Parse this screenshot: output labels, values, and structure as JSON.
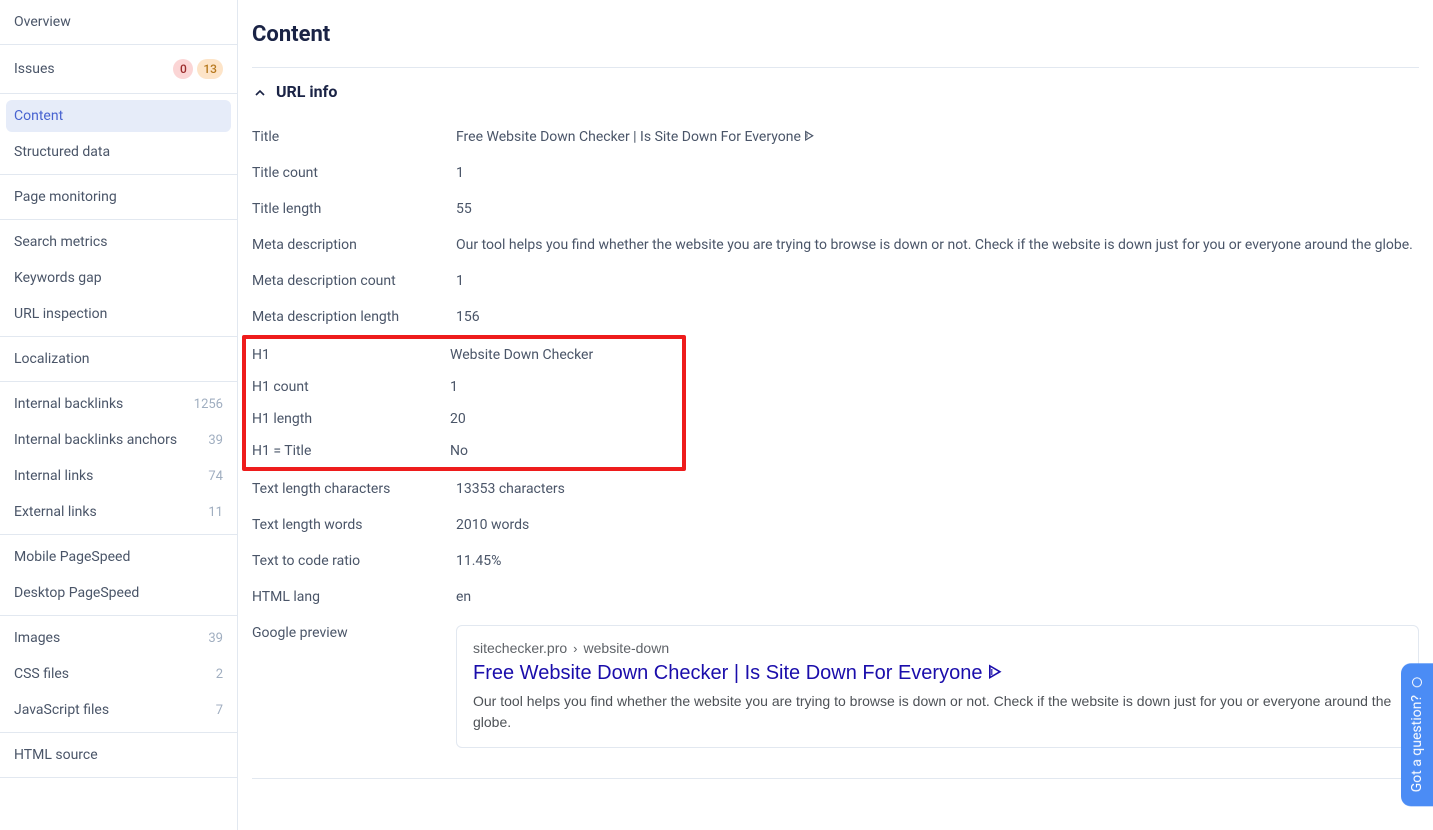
{
  "sidebar": {
    "items": [
      {
        "label": "Overview"
      },
      {
        "label": "Issues",
        "badge_red": "0",
        "badge_orange": "13"
      },
      {
        "label": "Content",
        "active": true
      },
      {
        "label": "Structured data"
      },
      {
        "label": "Page monitoring"
      },
      {
        "label": "Search metrics"
      },
      {
        "label": "Keywords gap"
      },
      {
        "label": "URL inspection"
      },
      {
        "label": "Localization"
      },
      {
        "label": "Internal backlinks",
        "count": "1256"
      },
      {
        "label": "Internal backlinks anchors",
        "count": "39"
      },
      {
        "label": "Internal links",
        "count": "74"
      },
      {
        "label": "External links",
        "count": "11"
      },
      {
        "label": "Mobile PageSpeed"
      },
      {
        "label": "Desktop PageSpeed"
      },
      {
        "label": "Images",
        "count": "39"
      },
      {
        "label": "CSS files",
        "count": "2"
      },
      {
        "label": "JavaScript files",
        "count": "7"
      },
      {
        "label": "HTML source"
      }
    ]
  },
  "page": {
    "title": "Content",
    "section": "URL info"
  },
  "url_info": {
    "title_label": "Title",
    "title_value": "Free Website Down Checker | Is Site Down For Everyone ᐈ",
    "title_count_label": "Title count",
    "title_count_value": "1",
    "title_length_label": "Title length",
    "title_length_value": "55",
    "meta_desc_label": "Meta description",
    "meta_desc_value": "Our tool helps you find whether the website you are trying to browse is down or not. Check if the website is down just for you or everyone around the globe.",
    "meta_desc_count_label": "Meta description count",
    "meta_desc_count_value": "1",
    "meta_desc_length_label": "Meta description length",
    "meta_desc_length_value": "156",
    "h1_label": "H1",
    "h1_value": "Website Down Checker",
    "h1_count_label": "H1 count",
    "h1_count_value": "1",
    "h1_length_label": "H1 length",
    "h1_length_value": "20",
    "h1_eq_title_label": "H1 = Title",
    "h1_eq_title_value": "No",
    "text_chars_label": "Text length characters",
    "text_chars_value": "13353 characters",
    "text_words_label": "Text length words",
    "text_words_value": "2010 words",
    "text_ratio_label": "Text to code ratio",
    "text_ratio_value": "11.45%",
    "html_lang_label": "HTML lang",
    "html_lang_value": "en",
    "google_preview_label": "Google preview"
  },
  "google_preview": {
    "domain": "sitechecker.pro",
    "path": "website-down",
    "title": "Free Website Down Checker | Is Site Down For Everyone ᐈ",
    "desc": "Our tool helps you find whether the website you are trying to browse is down or not. Check if the website is down just for you or everyone around the globe."
  },
  "help_tab": "Got a question?"
}
